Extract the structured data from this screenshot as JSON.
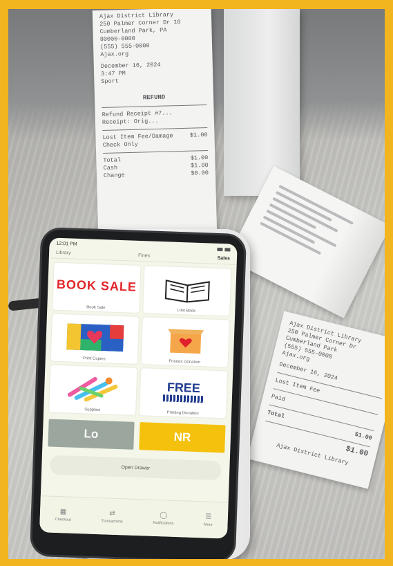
{
  "colors": {
    "frame": "#f2b51f",
    "lo_button": "#9ba79e",
    "nr_button": "#f4c20d",
    "book_sale_red": "#e2262a",
    "free_blue": "#1f3a8f"
  },
  "receipt_main": {
    "header_lines": [
      "Ajax District Library",
      "250 Palmer Corner Dr 10",
      "Cumberland Park, PA",
      "80000-0000",
      "(555) 555-0000",
      "Ajax.org",
      "December 16, 2024",
      "3:47 PM",
      "Sport"
    ],
    "title": "REFUND",
    "lines_1": [
      "Refund Receipt #7...",
      "Receipt: Orig..."
    ],
    "item_label": "Lost Item Fee/Damage",
    "item_sub": "Check Only",
    "item_amount": "$1.00",
    "total_label": "Total",
    "total_amount": "$1.00",
    "cash_label": "Cash",
    "cash_amount": "$1.00",
    "change_label": "Change",
    "change_amount": "$0.00"
  },
  "receipt_low": {
    "header_lines": [
      "Ajax District Library",
      "250 Palmer Corner Dr",
      "Cumberland Park",
      "(555) 555-0000",
      "Ajax.org"
    ],
    "date": "December 16, 2024",
    "line_1": "Lost Item Fee",
    "line_2": "Paid",
    "subtotal_label": "Total",
    "subtotal_amount": "$1.00",
    "total_amount": "$1.00",
    "footer": "Ajax District Library"
  },
  "phone": {
    "status_time": "12:01 PM",
    "top_tabs": [
      "Library",
      "Fines",
      "Sales"
    ],
    "tiles": [
      {
        "graphic": "BOOK SALE",
        "label": "Book Sale"
      },
      {
        "graphic": "book-icon",
        "label": "Lost Book"
      },
      {
        "graphic": "art-icon",
        "label": "Print Copies"
      },
      {
        "graphic": "gift-box-icon",
        "label": "Friends Donation"
      },
      {
        "graphic": "crafts-icon",
        "label": "Supplies"
      },
      {
        "graphic": "FREE",
        "label": "Printing Donation"
      }
    ],
    "lo_button": "Lo",
    "nr_button": "NR",
    "drawer_button": "Open Drawer",
    "nav": [
      {
        "icon": "grid-icon",
        "label": "Checkout"
      },
      {
        "icon": "arrows-icon",
        "label": "Transactions"
      },
      {
        "icon": "bell-icon",
        "label": "Notifications"
      },
      {
        "icon": "menu-icon",
        "label": "More"
      }
    ]
  }
}
